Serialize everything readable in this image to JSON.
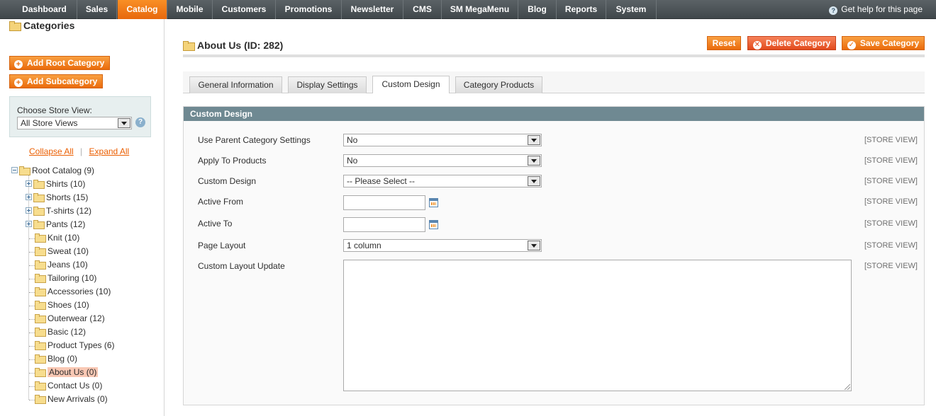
{
  "nav": {
    "items": [
      {
        "label": "Dashboard",
        "active": false
      },
      {
        "label": "Sales",
        "active": false
      },
      {
        "label": "Catalog",
        "active": true
      },
      {
        "label": "Mobile",
        "active": false
      },
      {
        "label": "Customers",
        "active": false
      },
      {
        "label": "Promotions",
        "active": false
      },
      {
        "label": "Newsletter",
        "active": false
      },
      {
        "label": "CMS",
        "active": false
      },
      {
        "label": "SM MegaMenu",
        "active": false
      },
      {
        "label": "Blog",
        "active": false
      },
      {
        "label": "Reports",
        "active": false
      },
      {
        "label": "System",
        "active": false
      }
    ],
    "help_label": "Get help for this page"
  },
  "sidebar": {
    "title": "Categories",
    "add_root_label": "Add Root Category",
    "add_sub_label": "Add Subcategory",
    "store_view_label": "Choose Store View:",
    "store_view_value": "All Store Views",
    "collapse_all": "Collapse All",
    "separator": "|",
    "expand_all": "Expand All",
    "tree": [
      {
        "label": "Root Catalog (9)",
        "level": 0,
        "expander": "minus",
        "selected": false
      },
      {
        "label": "Shirts (10)",
        "level": 1,
        "expander": "plus",
        "selected": false
      },
      {
        "label": "Shorts (15)",
        "level": 1,
        "expander": "plus",
        "selected": false
      },
      {
        "label": "T-shirts (12)",
        "level": 1,
        "expander": "plus",
        "selected": false
      },
      {
        "label": "Pants (12)",
        "level": 1,
        "expander": "plus",
        "selected": false
      },
      {
        "label": "Knit (10)",
        "level": 1,
        "expander": "",
        "selected": false
      },
      {
        "label": "Sweat (10)",
        "level": 1,
        "expander": "",
        "selected": false
      },
      {
        "label": "Jeans (10)",
        "level": 1,
        "expander": "",
        "selected": false
      },
      {
        "label": "Tailoring (10)",
        "level": 1,
        "expander": "",
        "selected": false
      },
      {
        "label": "Accessories (10)",
        "level": 1,
        "expander": "",
        "selected": false
      },
      {
        "label": "Shoes (10)",
        "level": 1,
        "expander": "",
        "selected": false
      },
      {
        "label": "Outerwear (12)",
        "level": 1,
        "expander": "",
        "selected": false
      },
      {
        "label": "Basic (12)",
        "level": 1,
        "expander": "",
        "selected": false
      },
      {
        "label": "Product Types (6)",
        "level": 1,
        "expander": "",
        "selected": false
      },
      {
        "label": "Blog (0)",
        "level": 1,
        "expander": "",
        "selected": false
      },
      {
        "label": "About Us (0)",
        "level": 1,
        "expander": "",
        "selected": true
      },
      {
        "label": "Contact Us (0)",
        "level": 1,
        "expander": "",
        "selected": false
      },
      {
        "label": "New Arrivals (0)",
        "level": 1,
        "expander": "",
        "selected": false
      }
    ]
  },
  "main": {
    "title": "About Us (ID: 282)",
    "buttons": {
      "reset": "Reset",
      "delete": "Delete Category",
      "save": "Save Category"
    },
    "tabs": [
      {
        "label": "General Information",
        "active": false
      },
      {
        "label": "Display Settings",
        "active": false
      },
      {
        "label": "Custom Design",
        "active": true
      },
      {
        "label": "Category Products",
        "active": false
      }
    ],
    "section_title": "Custom Design",
    "scope_label": "[STORE VIEW]",
    "fields": {
      "use_parent": {
        "label": "Use Parent Category Settings",
        "value": "No"
      },
      "apply_products": {
        "label": "Apply To Products",
        "value": "No"
      },
      "custom_design": {
        "label": "Custom Design",
        "value": "-- Please Select --"
      },
      "active_from": {
        "label": "Active From",
        "value": ""
      },
      "active_to": {
        "label": "Active To",
        "value": ""
      },
      "page_layout": {
        "label": "Page Layout",
        "value": "1 column"
      },
      "layout_update": {
        "label": "Custom Layout Update",
        "value": ""
      }
    }
  }
}
